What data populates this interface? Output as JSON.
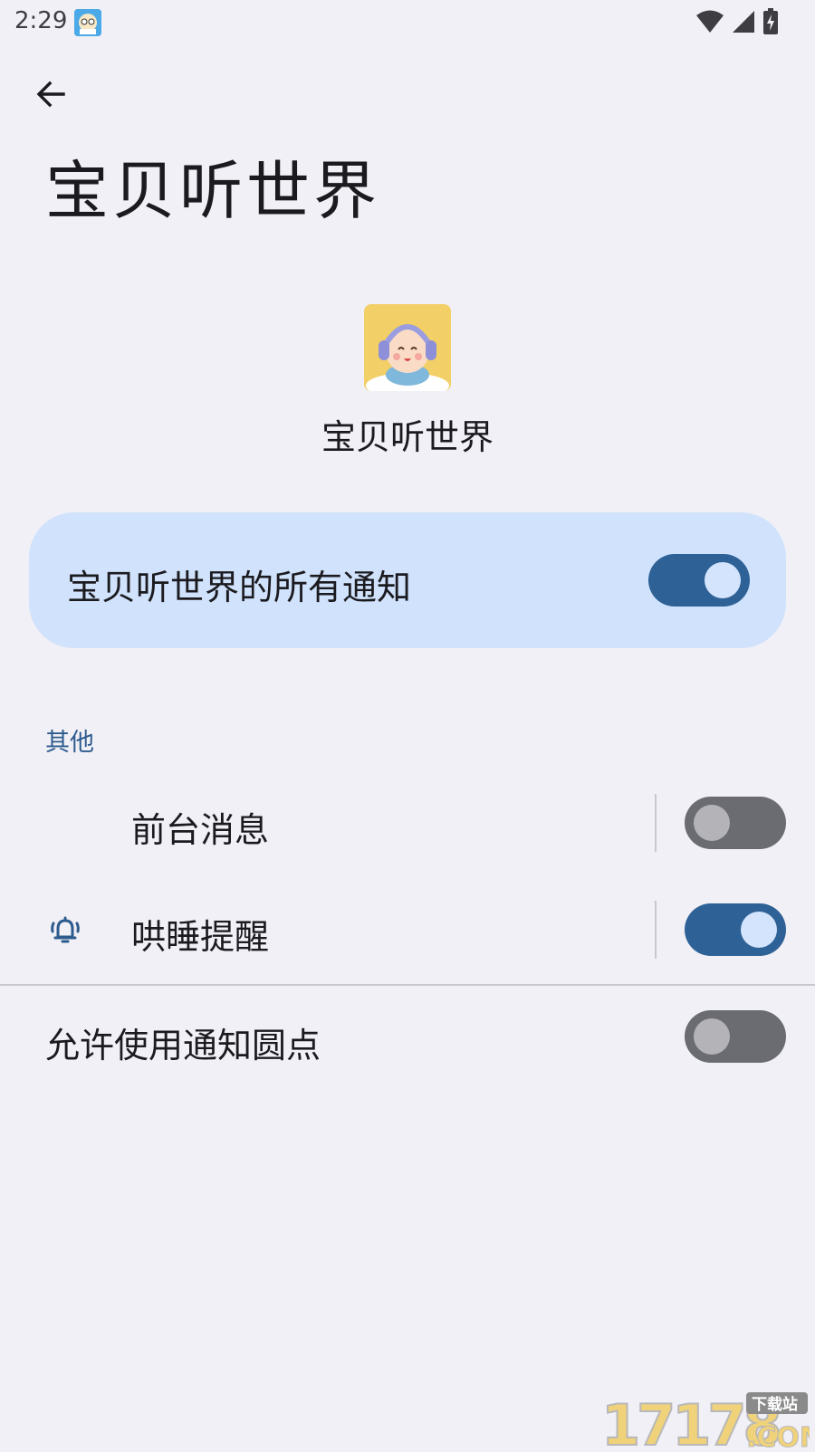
{
  "status_bar": {
    "time": "2:29",
    "icons": [
      "wifi-icon",
      "signal-icon",
      "battery-charging-icon"
    ]
  },
  "header": {
    "back_icon": "arrow-left-icon",
    "title": "宝贝听世界"
  },
  "app": {
    "name": "宝贝听世界",
    "icon": "baby-headphones-app-icon"
  },
  "master_toggle": {
    "label": "宝贝听世界的所有通知",
    "enabled": true
  },
  "section": {
    "title": "其他",
    "channels": [
      {
        "label": "前台消息",
        "enabled": false,
        "icon": null
      },
      {
        "label": "哄睡提醒",
        "enabled": true,
        "icon": "bell-ringing-icon"
      }
    ]
  },
  "dots_setting": {
    "label": "允许使用通知圆点",
    "enabled": false
  },
  "watermark": {
    "text": "17178",
    "sub": "下载站",
    "suffix": ".COM"
  },
  "colors": {
    "background": "#f1f0f6",
    "accent": "#2e6196",
    "card": "#d0e2fc",
    "section_header": "#2d5b8e"
  }
}
